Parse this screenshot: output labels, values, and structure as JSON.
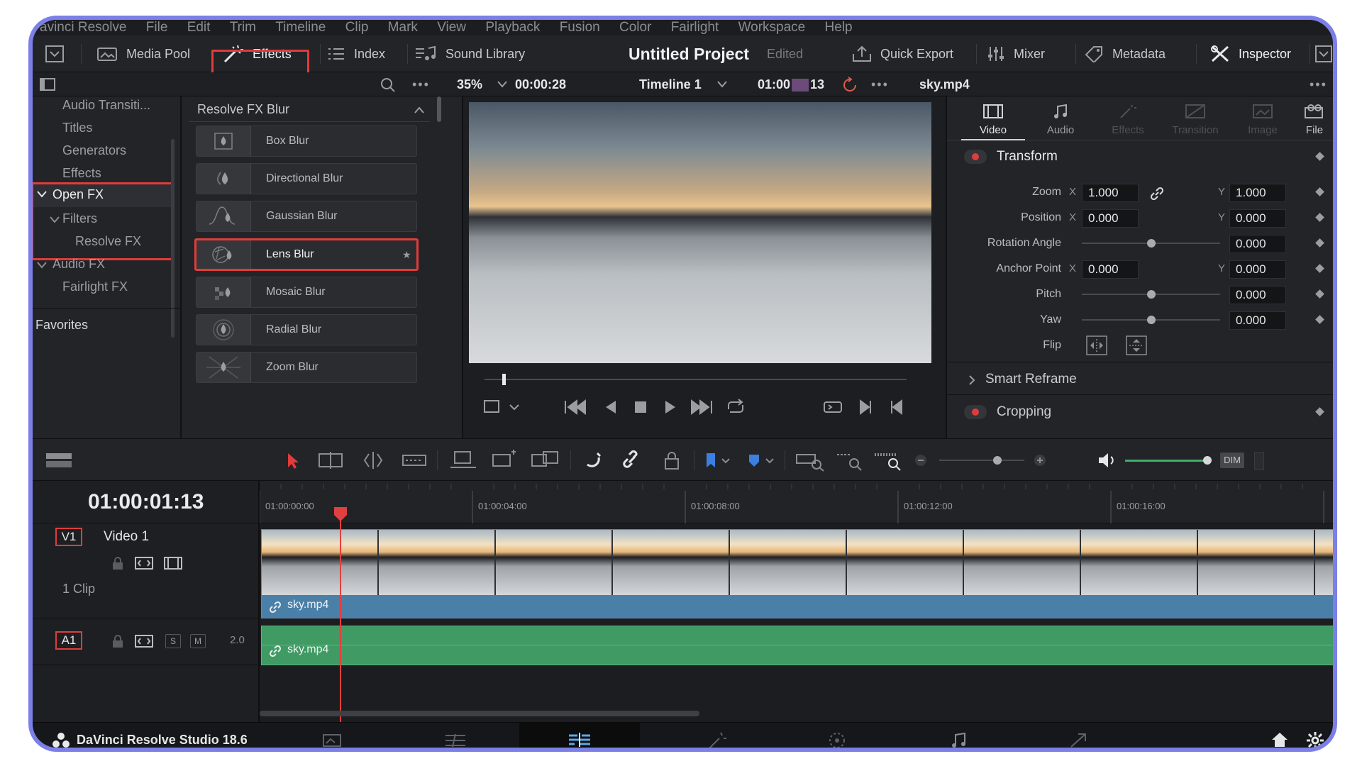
{
  "menu": [
    "avinci Resolve",
    "File",
    "Edit",
    "Trim",
    "Timeline",
    "Clip",
    "Mark",
    "View",
    "Playback",
    "Fusion",
    "Color",
    "Fairlight",
    "Workspace",
    "Help"
  ],
  "toolbar": {
    "media_pool": "Media Pool",
    "effects": "Effects",
    "index": "Index",
    "sound_library": "Sound Library",
    "project_title": "Untitled Project",
    "project_status": "Edited",
    "quick_export": "Quick Export",
    "mixer": "Mixer",
    "metadata": "Metadata",
    "inspector": "Inspector"
  },
  "viewer_bar": {
    "zoom": "35%",
    "timecode_left": "00:00:28",
    "timeline_name": "Timeline 1",
    "timecode_right_a": "01:00",
    "timecode_right_b": "13",
    "clip_name": "sky.mp4"
  },
  "effects_tree": {
    "items": [
      "Audio Transiti...",
      "Titles",
      "Generators",
      "Effects",
      "Open FX",
      "Filters",
      "Resolve FX",
      "Audio FX",
      "Fairlight FX"
    ],
    "favorites": "Favorites"
  },
  "fx_list": {
    "header": "Resolve FX Blur",
    "items": [
      "Box Blur",
      "Directional Blur",
      "Gaussian Blur",
      "Lens Blur",
      "Mosaic Blur",
      "Radial Blur",
      "Zoom Blur"
    ],
    "selected_index": 3
  },
  "inspector": {
    "tabs": [
      "Video",
      "Audio",
      "Effects",
      "Transition",
      "Image",
      "File"
    ],
    "active_tab": "Video",
    "transform_title": "Transform",
    "rows": {
      "zoom": {
        "label": "Zoom",
        "x_axis": "X",
        "x": "1.000",
        "y_axis": "Y",
        "y": "1.000"
      },
      "position": {
        "label": "Position",
        "x_axis": "X",
        "x": "0.000",
        "y_axis": "Y",
        "y": "0.000"
      },
      "rotation": {
        "label": "Rotation Angle",
        "value": "0.000"
      },
      "anchor": {
        "label": "Anchor Point",
        "x_axis": "X",
        "x": "0.000",
        "y_axis": "Y",
        "y": "0.000"
      },
      "pitch": {
        "label": "Pitch",
        "value": "0.000"
      },
      "yaw": {
        "label": "Yaw",
        "value": "0.000"
      },
      "flip": {
        "label": "Flip"
      }
    },
    "smart_reframe": "Smart Reframe",
    "cropping": "Cropping"
  },
  "timeline": {
    "timecode": "01:00:01:13",
    "ruler": [
      "01:00:00:00",
      "01:00:04:00",
      "01:00:08:00",
      "01:00:12:00",
      "01:00:16:00"
    ],
    "video_track": {
      "id": "V1",
      "name": "Video 1",
      "clips_label": "1 Clip",
      "clip_name": "sky.mp4"
    },
    "audio_track": {
      "id": "A1",
      "solo": "S",
      "mute": "M",
      "level": "2.0",
      "clip_name": "sky.mp4"
    },
    "dim_label": "DIM"
  },
  "footer": {
    "app_name": "DaVinci Resolve Studio 18.6"
  },
  "colors": {
    "accent_blue": "#4a7fa8",
    "audio_green": "#3f9a63",
    "highlight_red": "#e23b3b",
    "playhead": "#e04040",
    "frame_border": "#7b7fe6"
  }
}
